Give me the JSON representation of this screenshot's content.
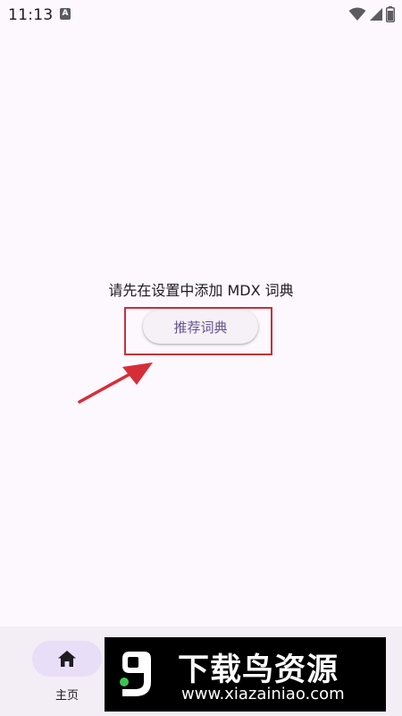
{
  "status_bar": {
    "time": "11:13",
    "notification_icon": "a-box-icon",
    "icons": [
      "wifi-icon",
      "signal-icon",
      "battery-icon"
    ]
  },
  "main": {
    "message": "请先在设置中添加 MDX 词典",
    "recommend_button": "推荐词典"
  },
  "bottom_nav": {
    "items": [
      {
        "label": "主页",
        "icon": "home-icon",
        "active": true
      }
    ]
  },
  "watermark": {
    "title": "下载鸟资源",
    "url": "www.xiazainiao.com"
  },
  "colors": {
    "background": "#fdf7fe",
    "accent_text": "#65558f",
    "highlight_border": "#c3323b",
    "nav_background": "#f3edf6",
    "nav_active_pill": "#e8def8"
  }
}
